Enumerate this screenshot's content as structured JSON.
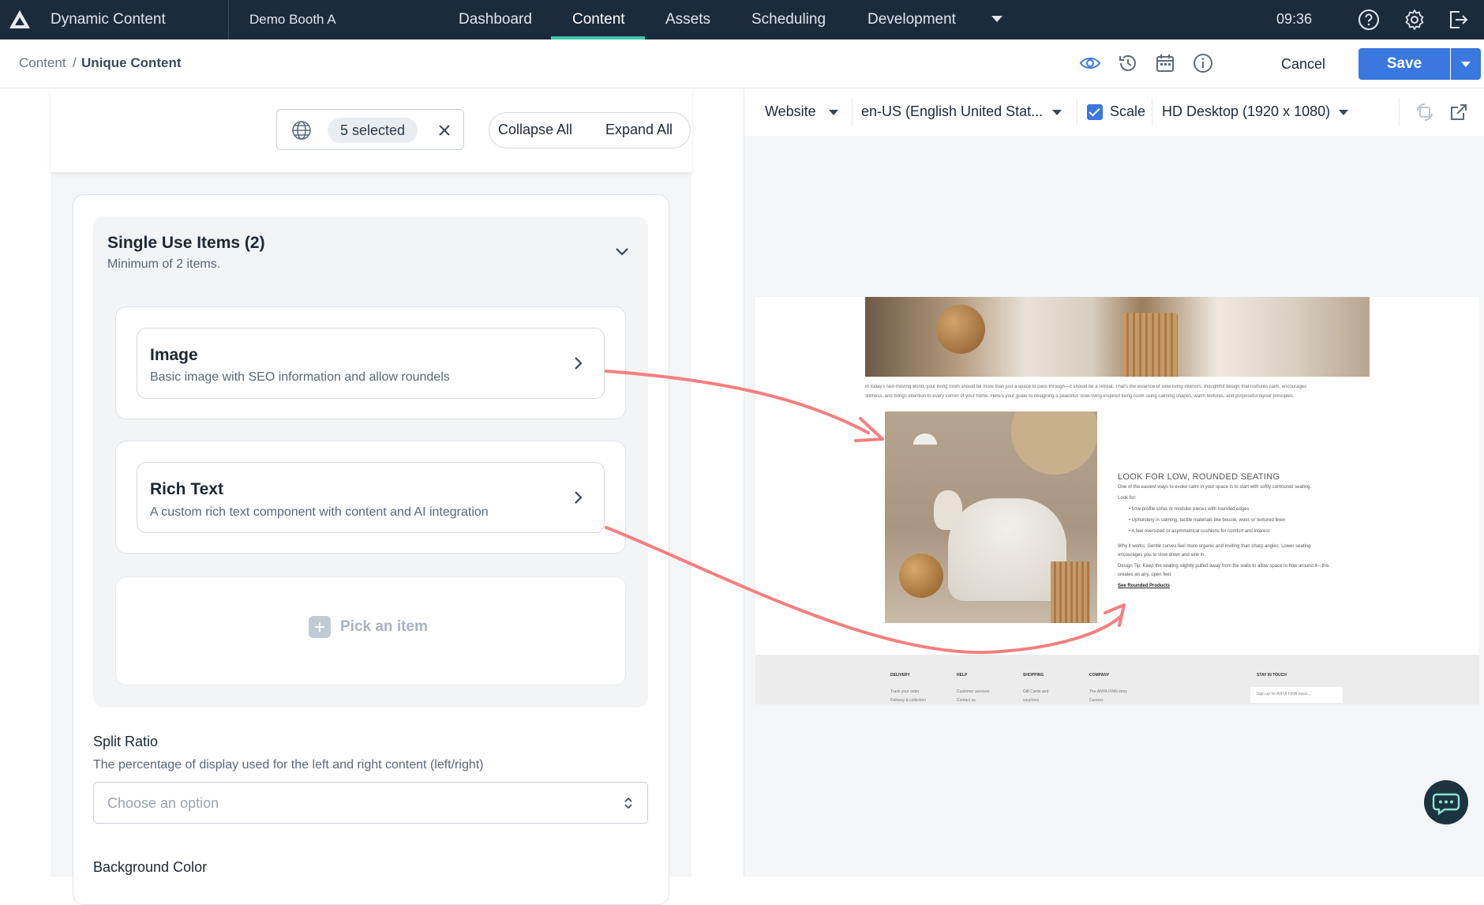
{
  "topbar": {
    "app_title": "Dynamic Content",
    "workspace": "Demo Booth A",
    "tabs": [
      {
        "label": "Dashboard"
      },
      {
        "label": "Content"
      },
      {
        "label": "Assets"
      },
      {
        "label": "Scheduling"
      },
      {
        "label": "Development"
      }
    ],
    "active_tab": "Content",
    "clock": "09:36",
    "icons": [
      "help-icon",
      "gear-icon",
      "logout-icon"
    ]
  },
  "breadcrumb": {
    "root": "Content",
    "separator": "/",
    "current": "Unique Content"
  },
  "actions": {
    "cancel_label": "Cancel",
    "save_label": "Save"
  },
  "editor": {
    "locale_selection": "5 selected",
    "collapse_all": "Collapse All",
    "expand_all": "Expand All",
    "group": {
      "title": "Single Use Items (2)",
      "subtitle": "Minimum of 2 items.",
      "items": [
        {
          "title": "Image",
          "description": "Basic image with SEO information and allow roundels"
        },
        {
          "title": "Rich Text",
          "description": "A custom rich text component with content and AI integration"
        }
      ],
      "pick_label": "Pick an item"
    },
    "split_ratio": {
      "label": "Split Ratio",
      "help": "The percentage of display used for the left and right content (left/right)",
      "placeholder": "Choose an option"
    },
    "background_color_label": "Background Color"
  },
  "preview": {
    "channel": "Website",
    "locale": "en-US (English United Stat...",
    "scale_label": "Scale",
    "scale_checked": true,
    "device": "HD Desktop (1920 x 1080)",
    "site": {
      "intro_lines": [
        "In today's fast-moving world, your living room should be more than just a space to pass through—it should be a retreat. That's the essence of slow living interiors: thoughtful design that nurtures calm, encourages",
        "stillness, and brings intention to every corner of your home. Here's your guide to designing a peaceful, slow-living-inspired living room using calming shapes, warm textures, and purposeful layout principles."
      ],
      "heading": "LOOK FOR LOW, ROUNDED SEATING",
      "body_lines": [
        "One of the easiest ways to evoke calm in your space is to start with softly contoured seating.",
        "Look for:"
      ],
      "bullets": [
        "Low-profile sofas or modular pieces with rounded edges",
        "Upholstery in calming, tactile materials like bouclé, wool, or textured linen",
        "A few oversized or asymmetrical cushions for comfort and interest"
      ],
      "why_lines": [
        "Why it works: Gentle curves feel more organic and inviting than sharp angles. Lower seating",
        "encourages you to slow down and sink in."
      ],
      "tip_lines": [
        "Design Tip: Keep the seating slightly pulled away from the walls to allow space to flow around it—this",
        "creates an airy, open feel."
      ],
      "link": "See Rounded Products",
      "footer": {
        "columns": [
          {
            "heading": "DELIVERY",
            "links": [
              "Track your order",
              "Delivery & collection"
            ]
          },
          {
            "heading": "HELP",
            "links": [
              "Customer services",
              "Contact us"
            ]
          },
          {
            "heading": "SHOPPING",
            "links": [
              "Gift Cards and",
              "vouchers"
            ]
          },
          {
            "heading": "COMPANY",
            "links": [
              "The ANYA FINN story",
              "Careers"
            ]
          }
        ],
        "stay_heading": "STAY IN TOUCH",
        "signup_placeholder": "Sign up for ANYA FINN news..."
      }
    }
  },
  "colors": {
    "nav_bg": "#1c2b3c",
    "accent": "#3a78e0",
    "active_tab_underline": "#3ec6a6",
    "annotation_arrow": "#f47f7f"
  }
}
